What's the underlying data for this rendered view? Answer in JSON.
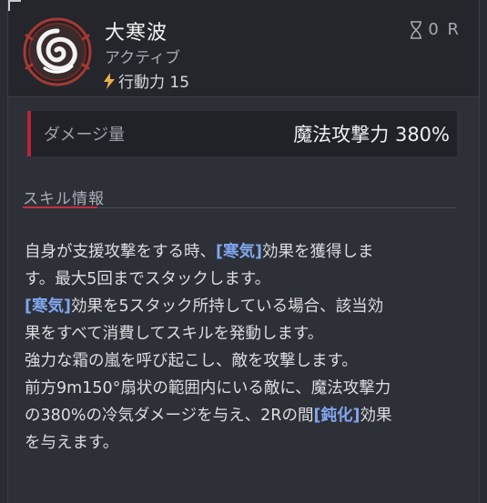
{
  "skill": {
    "name": "大寒波",
    "type": "アクティブ",
    "action_points": "行動力 15",
    "cooldown": "0 R",
    "icon": "swirl-icon"
  },
  "damage": {
    "label": "ダメージ量",
    "value": "魔法攻撃力 380%"
  },
  "section": {
    "title": "スキル情報"
  },
  "description": {
    "l1a": "自身が支援攻撃をする時、",
    "l1kw": "[寒気]",
    "l1b": "効果を獲得しま",
    "l2": "す。最大5回までスタックします。",
    "l3kw": "[寒気]",
    "l3b": "効果を5スタック所持している場合、該当効",
    "l4": "果をすべて消費してスキルを発動します。",
    "l5": "強力な霜の嵐を呼び起こし、敵を攻撃します。",
    "l6": "前方9m150°扇状の範囲内にいる敵に、魔法攻撃力",
    "l7a": "の380%の冷気ダメージを与え、2Rの間",
    "l7kw": "[鈍化]",
    "l7b": "効果",
    "l8": "を与えます。"
  },
  "colors": {
    "accent": "#b8233d",
    "keyword": "#7fa6ee",
    "panel": "#2e3038"
  }
}
